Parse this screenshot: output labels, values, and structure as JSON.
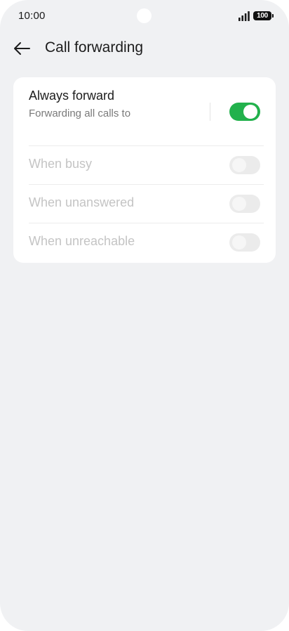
{
  "status_bar": {
    "time": "10:00",
    "battery": "100"
  },
  "header": {
    "title": "Call forwarding"
  },
  "settings": {
    "always_forward": {
      "title": "Always forward",
      "subtitle": "Forwarding all calls to",
      "enabled": true
    },
    "options": [
      {
        "label": "When busy",
        "enabled": false
      },
      {
        "label": "When unanswered",
        "enabled": false
      },
      {
        "label": "When unreachable",
        "enabled": false
      }
    ]
  },
  "colors": {
    "background": "#f0f1f3",
    "card": "#ffffff",
    "accent_green": "#22b14c",
    "disabled_text": "#c4c4c4"
  },
  "icons": {
    "back": "arrow-left-icon",
    "signal": "signal-icon",
    "battery": "battery-icon"
  }
}
